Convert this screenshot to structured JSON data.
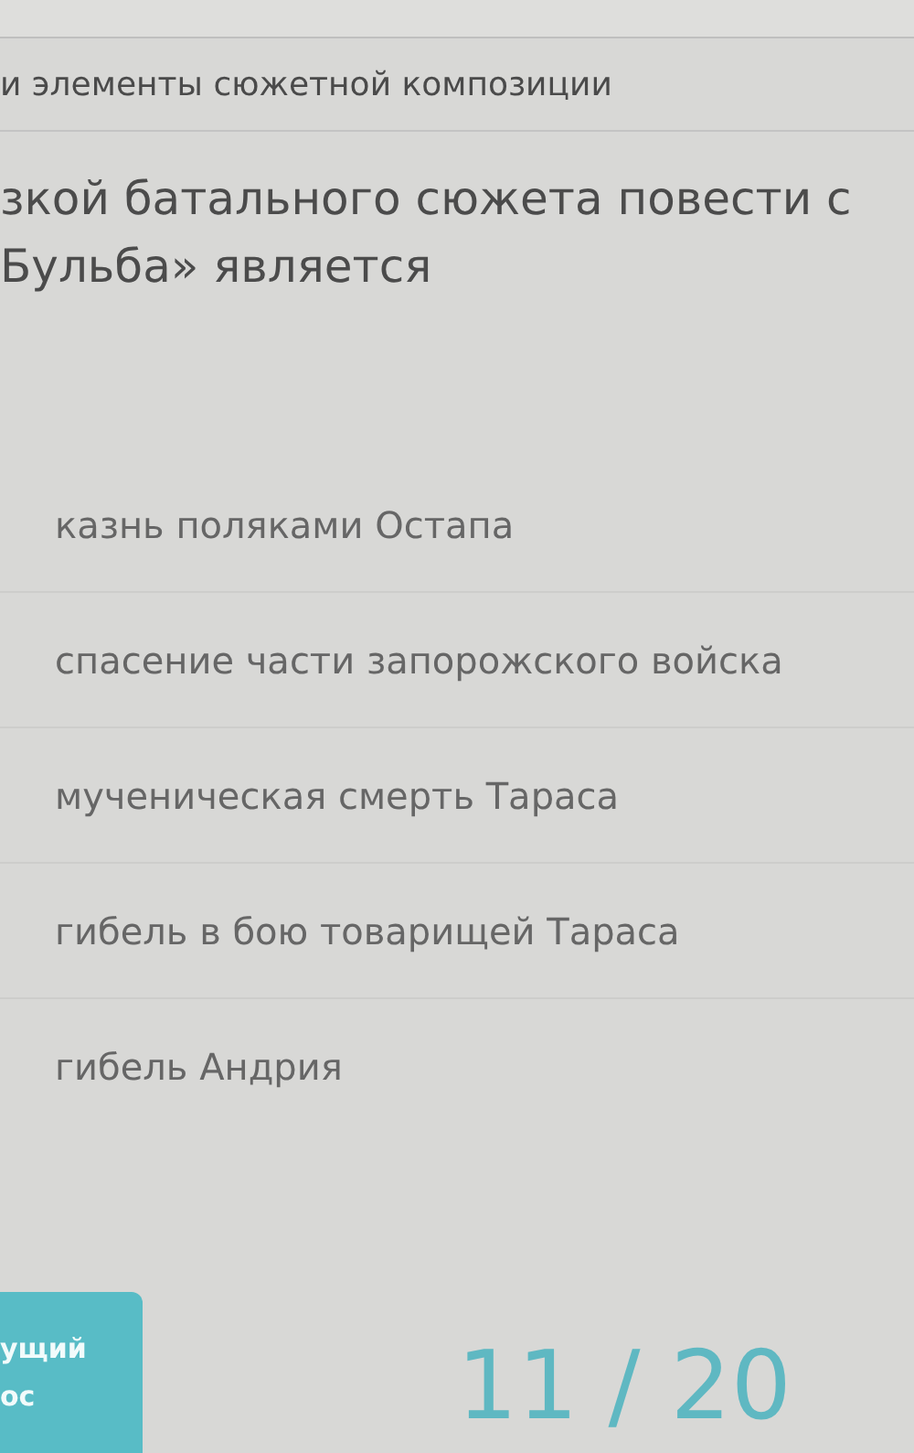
{
  "section_title": "и элементы сюжетной композиции",
  "question": "зкой батального сюжета повести с Бульба» является",
  "options": [
    {
      "label": "казнь поляками Остапа"
    },
    {
      "label": "спасение части запорожского войска"
    },
    {
      "label": "мученическая смерть Тараса"
    },
    {
      "label": "гибель в бою товарищей Тараса"
    },
    {
      "label": "гибель Андрия"
    }
  ],
  "next_button": "ущий ос",
  "counter": "11 / 20"
}
